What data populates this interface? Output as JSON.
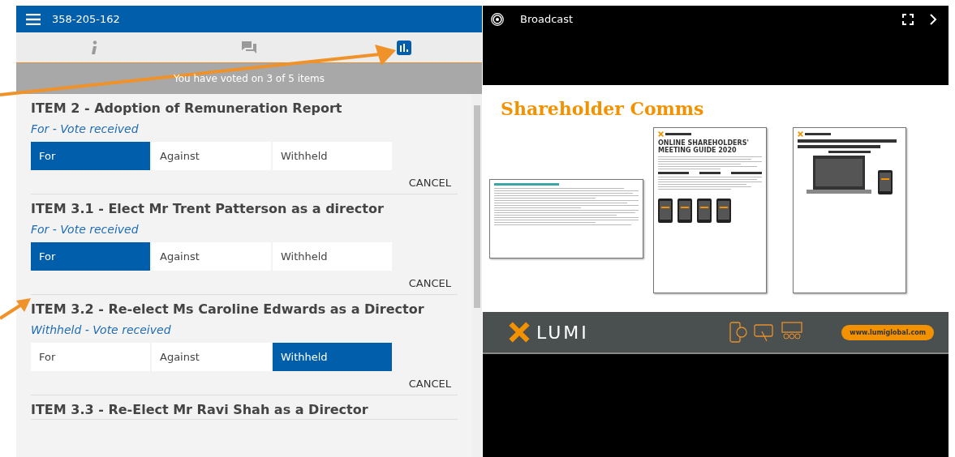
{
  "header": {
    "meeting_id": "358-205-162"
  },
  "tabs": [
    {
      "selected": false
    },
    {
      "selected": false
    },
    {
      "selected": true
    }
  ],
  "banner": "You have voted on 3 of 5 items",
  "items": [
    {
      "title": "ITEM 2 - Adoption of Remuneration Report",
      "status": "For - Vote received",
      "options": [
        {
          "label": "For",
          "selected": true
        },
        {
          "label": "Against",
          "selected": false
        },
        {
          "label": "Withheld",
          "selected": false
        }
      ],
      "cancel": "CANCEL"
    },
    {
      "title": "ITEM 3.1 - Elect Mr Trent Patterson as a director",
      "status": "For - Vote received",
      "options": [
        {
          "label": "For",
          "selected": true
        },
        {
          "label": "Against",
          "selected": false
        },
        {
          "label": "Withheld",
          "selected": false
        }
      ],
      "cancel": "CANCEL"
    },
    {
      "title": "ITEM 3.2 - Re-elect Ms Caroline Edwards as a Director",
      "status": "Withheld - Vote received",
      "options": [
        {
          "label": "For",
          "selected": false
        },
        {
          "label": "Against",
          "selected": false
        },
        {
          "label": "Withheld",
          "selected": true
        }
      ],
      "cancel": "CANCEL"
    },
    {
      "title": "ITEM 3.3 - Re-Elect Mr Ravi Shah as a Director"
    }
  ],
  "broadcast": {
    "title": "Broadcast",
    "slide": {
      "title": "Shareholder Comms",
      "documents": [
        {
          "kind": "letter"
        },
        {
          "kind": "guide",
          "title": "ONLINE SHAREHOLDERS' MEETING GUIDE 2020"
        },
        {
          "kind": "flyer"
        }
      ],
      "footer": {
        "brand": "LUMI",
        "url": "www.lumiglobal.com"
      }
    }
  }
}
